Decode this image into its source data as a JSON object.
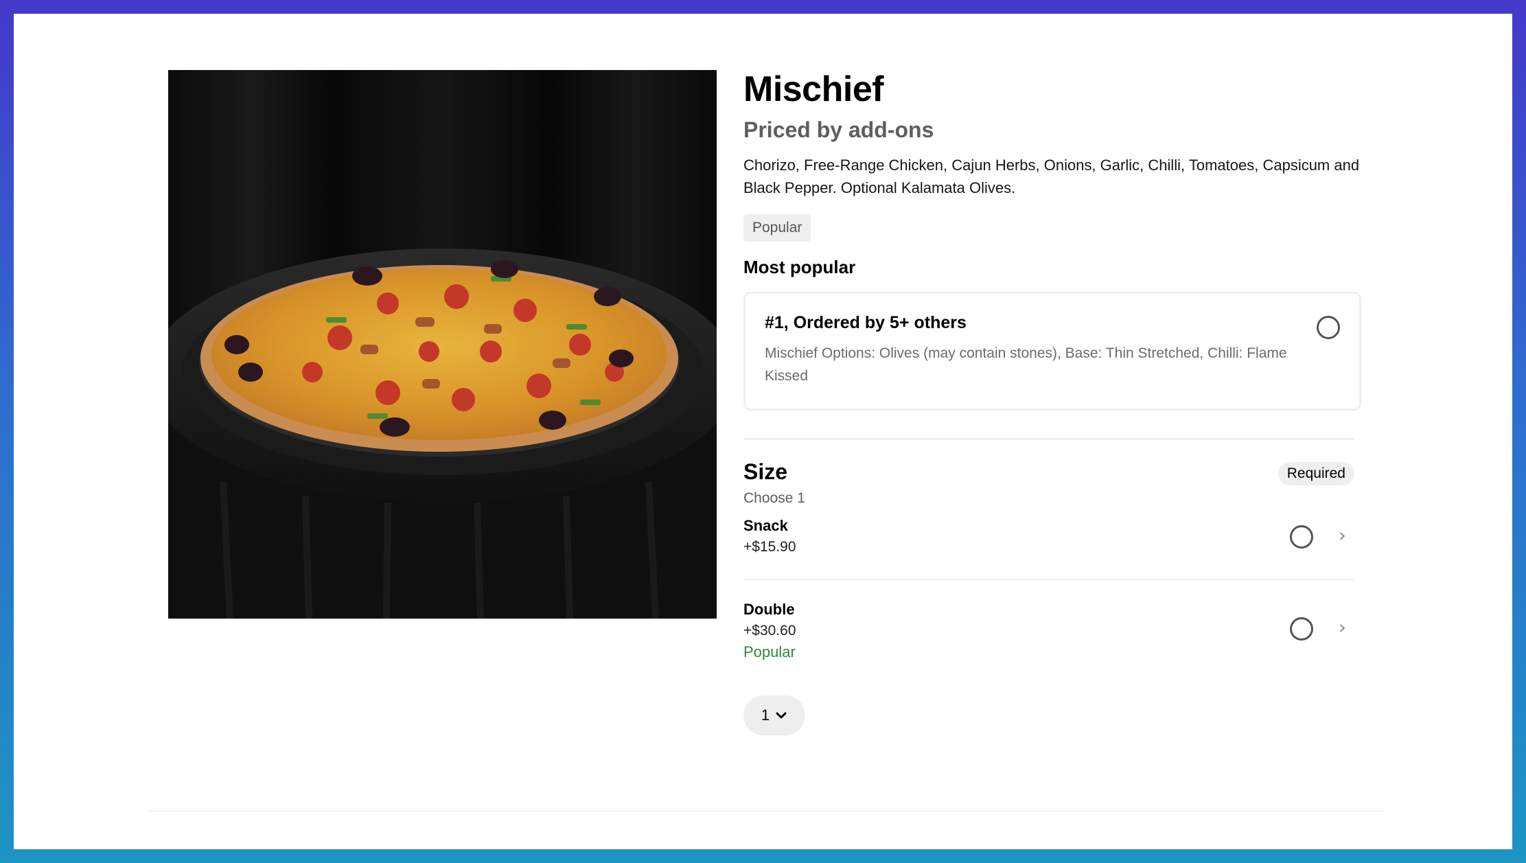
{
  "item": {
    "name": "Mischief",
    "pricing": "Priced by add-ons",
    "description": "Chorizo, Free-Range Chicken, Cajun Herbs, Onions, Garlic, Chilli, Tomatoes, Capsicum and Black Pepper. Optional Kalamata Olives.",
    "badge": "Popular",
    "image_icon": "pizza-photo"
  },
  "most_popular": {
    "heading": "Most popular",
    "card_title": "#1, Ordered by 5+ others",
    "card_description": "Mischief Options: Olives (may contain stones), Base: Thin Stretched, Chilli: Flame Kissed"
  },
  "size": {
    "title": "Size",
    "subtitle": "Choose 1",
    "required_label": "Required",
    "options": [
      {
        "name": "Snack",
        "price": "+$15.90",
        "tag": ""
      },
      {
        "name": "Double",
        "price": "+$30.60",
        "tag": "Popular"
      }
    ]
  },
  "quantity": {
    "value": "1"
  },
  "colors": {
    "accent_green": "#2f8a3c",
    "pill_bg": "#efefef",
    "frame_gradient_top": "#4438c9",
    "frame_gradient_bottom": "#1c94c4"
  }
}
